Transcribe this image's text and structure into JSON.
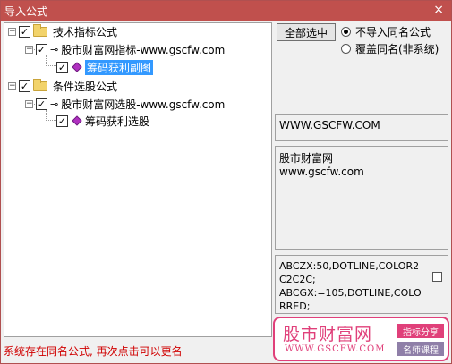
{
  "window": {
    "title": "导入公式",
    "close_glyph": "×"
  },
  "tree": {
    "nodes": [
      {
        "label": "技术指标公式",
        "checked": true
      },
      {
        "label": "股市财富网指标-www.gscfw.com",
        "checked": true
      },
      {
        "label": "筹码获利副图",
        "checked": true,
        "selected": true
      },
      {
        "label": "条件选股公式",
        "checked": true
      },
      {
        "label": "股市财富网选股-www.gscfw.com",
        "checked": true
      },
      {
        "label": "筹码获利选股",
        "checked": true
      }
    ]
  },
  "controls": {
    "select_all_label": "全部选中",
    "radio_skip_label": "不导入同名公式",
    "radio_overwrite_label": "覆盖同名(非系统)"
  },
  "panels": {
    "url_text": "WWW.GSCFW.COM",
    "desc_line1": "股市财富网",
    "desc_line2": "www.gscfw.com",
    "code_text": "ABCZX:50,DOTLINE,COLOR2\nC2C2C;\nABCGX:=105,DOTLINE,COLO\nRRED;"
  },
  "status": {
    "message": "系统存在同名公式, 再次点击可以更名"
  },
  "logo": {
    "name": "股市财富网",
    "url": "WWW.GSCFW.COM",
    "tag1": "指标分享",
    "tag2": "名师课程"
  },
  "colors": {
    "title_bar": "#c0504d",
    "selection": "#3399ff",
    "status_text": "#d00000",
    "logo_pink": "#e0407a"
  }
}
